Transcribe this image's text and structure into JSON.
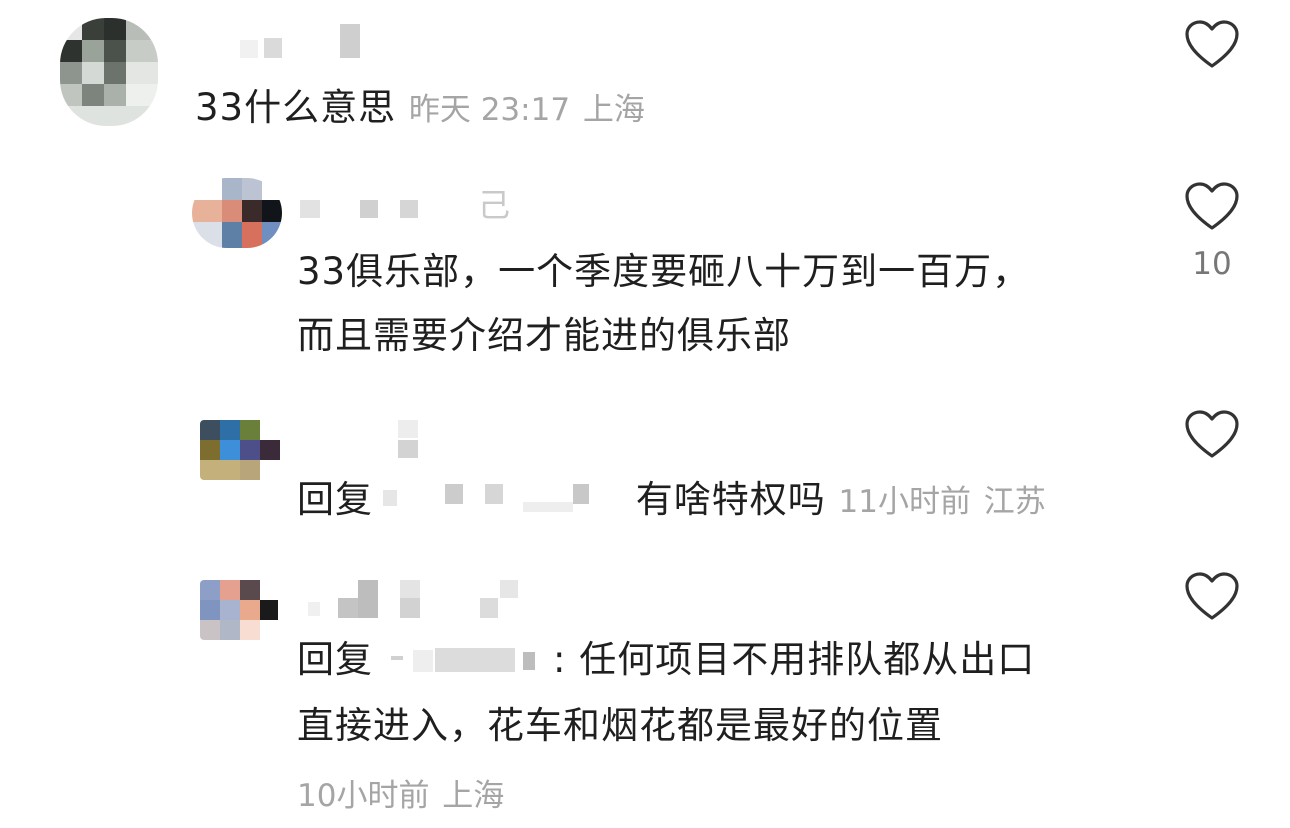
{
  "comments": [
    {
      "text": "33什么意思",
      "time": "昨天 23:17",
      "location": "上海",
      "like_icon": "heart-outline-icon"
    },
    {
      "name_fragment": "己",
      "text_lines": [
        "33俱乐部，一个季度要砸八十万到一百万，",
        "而且需要介绍才能进的俱乐部"
      ],
      "like_icon": "heart-outline-icon",
      "likes": "10"
    },
    {
      "reply_prefix": "回复",
      "text": "有啥特权吗",
      "time": "11小时前",
      "location": "江苏",
      "like_icon": "heart-outline-icon"
    },
    {
      "reply_prefix": "回复",
      "text_line1": ": 任何项目不用排队都从出口",
      "text_line2": "直接进入，花车和烟花都是最好的位置",
      "time": "10小时前",
      "location": "上海",
      "like_icon": "heart-outline-icon"
    }
  ]
}
